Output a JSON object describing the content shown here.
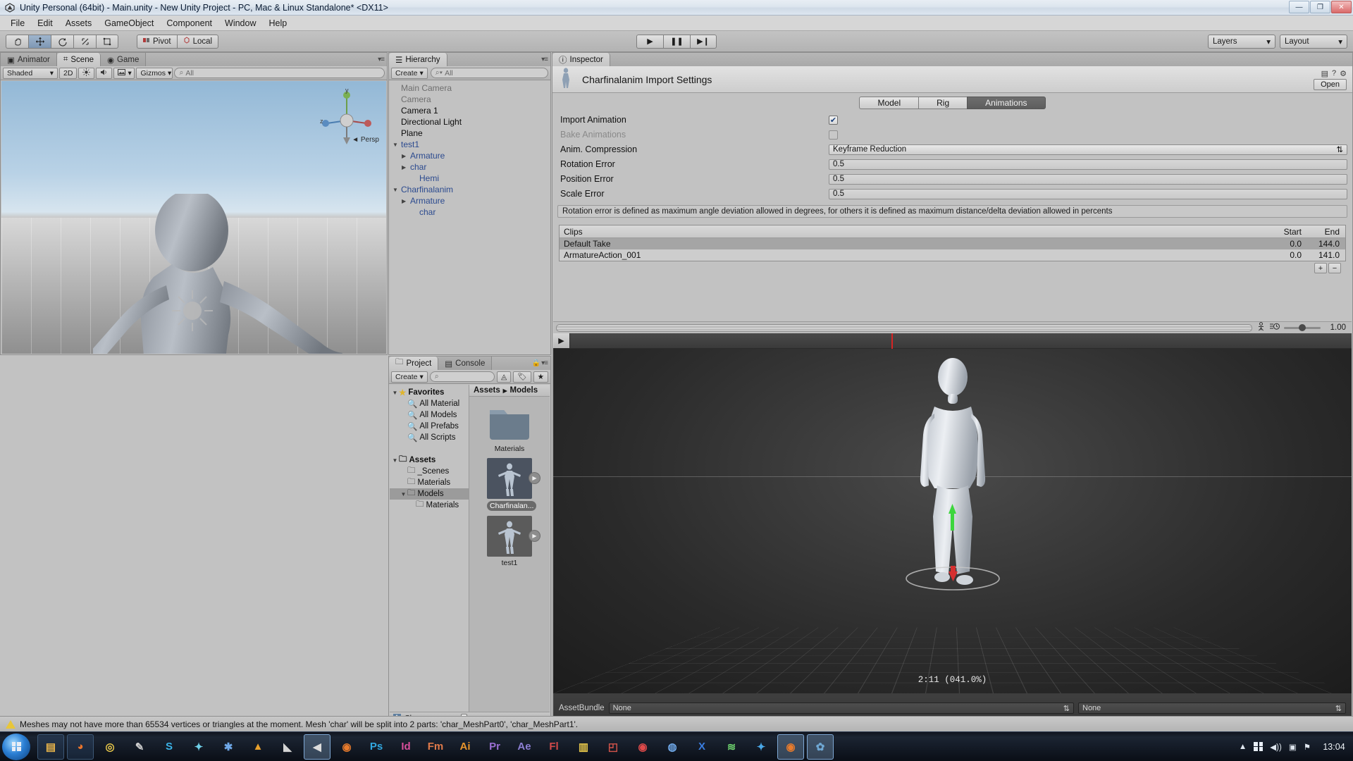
{
  "window": {
    "title": "Unity Personal (64bit) - Main.unity - New Unity Project - PC, Mac & Linux Standalone* <DX11>",
    "minimize": "—",
    "maximize": "❐",
    "close": "✕"
  },
  "menubar": {
    "items": [
      "File",
      "Edit",
      "Assets",
      "GameObject",
      "Component",
      "Window",
      "Help"
    ]
  },
  "toolbar": {
    "tools": [
      "hand-tool",
      "move-tool",
      "rotate-tool",
      "scale-tool",
      "rect-tool"
    ],
    "pivot_label": "Pivot",
    "space_label": "Local",
    "play": "▶",
    "pause": "❚❚",
    "step": "▶❙",
    "layers_label": "Layers",
    "layout_label": "Layout"
  },
  "scene": {
    "tabs": [
      {
        "label": "Scene",
        "active": true
      },
      {
        "label": "Game",
        "active": false
      },
      {
        "label": "Animator",
        "active": false
      }
    ],
    "shading_mode": "Shaded",
    "mode_2d": "2D",
    "gizmos_label": "Gizmos",
    "search_placeholder": "All",
    "axis_x": "x",
    "axis_y": "y",
    "axis_z": "z",
    "persp_label": "Persp"
  },
  "hierarchy": {
    "tab_label": "Hierarchy",
    "create_label": "Create",
    "search_placeholder": "All",
    "items": [
      {
        "label": "Main Camera",
        "indent": 0,
        "arrow": "",
        "style": "dim"
      },
      {
        "label": "Camera",
        "indent": 0,
        "arrow": "",
        "style": "dim"
      },
      {
        "label": "Camera 1",
        "indent": 0,
        "arrow": "",
        "style": "normal"
      },
      {
        "label": "Directional Light",
        "indent": 0,
        "arrow": "",
        "style": "normal"
      },
      {
        "label": "Plane",
        "indent": 0,
        "arrow": "",
        "style": "normal"
      },
      {
        "label": "test1",
        "indent": 0,
        "arrow": "▼",
        "style": "prefab"
      },
      {
        "label": "Armature",
        "indent": 1,
        "arrow": "▶",
        "style": "prefab"
      },
      {
        "label": "char",
        "indent": 1,
        "arrow": "▶",
        "style": "prefab"
      },
      {
        "label": "Hemi",
        "indent": 2,
        "arrow": "",
        "style": "prefab"
      },
      {
        "label": "Charfinalanim",
        "indent": 0,
        "arrow": "▼",
        "style": "prefab"
      },
      {
        "label": "Armature",
        "indent": 1,
        "arrow": "▶",
        "style": "prefab"
      },
      {
        "label": "char",
        "indent": 2,
        "arrow": "",
        "style": "prefab"
      }
    ]
  },
  "project": {
    "tabs": [
      {
        "label": "Project",
        "active": true
      },
      {
        "label": "Console",
        "active": false
      }
    ],
    "create_label": "Create",
    "search_placeholder": "",
    "tree": [
      {
        "label": "Favorites",
        "indent": 0,
        "arrow": "▼",
        "icon": "star-icon",
        "bold": true,
        "selected": false
      },
      {
        "label": "All Material",
        "indent": 1,
        "arrow": "",
        "icon": "search-icon",
        "bold": false,
        "selected": false
      },
      {
        "label": "All Models",
        "indent": 1,
        "arrow": "",
        "icon": "search-icon",
        "bold": false,
        "selected": false
      },
      {
        "label": "All Prefabs",
        "indent": 1,
        "arrow": "",
        "icon": "search-icon",
        "bold": false,
        "selected": false
      },
      {
        "label": "All Scripts",
        "indent": 1,
        "arrow": "",
        "icon": "search-icon",
        "bold": false,
        "selected": false
      },
      {
        "label": "",
        "indent": 0,
        "arrow": "",
        "icon": "",
        "bold": false,
        "selected": false
      },
      {
        "label": "Assets",
        "indent": 0,
        "arrow": "▼",
        "icon": "folder-icon",
        "bold": true,
        "selected": false
      },
      {
        "label": "_Scenes",
        "indent": 1,
        "arrow": "",
        "icon": "folder-icon",
        "bold": false,
        "selected": false
      },
      {
        "label": "Materials",
        "indent": 1,
        "arrow": "",
        "icon": "folder-icon",
        "bold": false,
        "selected": false
      },
      {
        "label": "Models",
        "indent": 1,
        "arrow": "▼",
        "icon": "folder-icon",
        "bold": false,
        "selected": true
      },
      {
        "label": "Materials",
        "indent": 2,
        "arrow": "",
        "icon": "folder-icon",
        "bold": false,
        "selected": false
      }
    ],
    "breadcrumb": [
      "Assets",
      "Models"
    ],
    "breadcrumb_sep": "▸",
    "assets": [
      {
        "label": "Materials",
        "type": "folder",
        "selected": false,
        "has_play": false
      },
      {
        "label": "Charfinalan...",
        "type": "model",
        "selected": true,
        "has_play": true
      },
      {
        "label": "test1",
        "type": "model",
        "selected": false,
        "has_play": true
      }
    ],
    "footer_label": "Char"
  },
  "inspector": {
    "tab_label": "Inspector",
    "title": "Charfinalanim Import Settings",
    "open_label": "Open",
    "mode_tabs": [
      {
        "label": "Model",
        "active": false
      },
      {
        "label": "Rig",
        "active": false
      },
      {
        "label": "Animations",
        "active": true
      }
    ],
    "fields": [
      {
        "label": "Import Animation",
        "type": "checkbox",
        "value": "✔",
        "checked": true,
        "disabled": false
      },
      {
        "label": "Bake Animations",
        "type": "checkbox",
        "value": "",
        "checked": false,
        "disabled": true
      },
      {
        "label": "Anim. Compression",
        "type": "popup",
        "value": "Keyframe Reduction",
        "disabled": false
      },
      {
        "label": "Rotation Error",
        "type": "text",
        "value": "0.5",
        "disabled": false
      },
      {
        "label": "Position Error",
        "type": "text",
        "value": "0.5",
        "disabled": false
      },
      {
        "label": "Scale Error",
        "type": "text",
        "value": "0.5",
        "disabled": false
      }
    ],
    "helpbox": "Rotation error is defined as maximum angle deviation allowed in degrees, for others it is defined as maximum distance/delta deviation allowed in percents",
    "clips": {
      "header": {
        "name": "Clips",
        "start": "Start",
        "end": "End"
      },
      "rows": [
        {
          "name": "Default Take",
          "start": "0.0",
          "end": "144.0",
          "selected": true
        },
        {
          "name": "ArmatureAction_001",
          "start": "0.0",
          "end": "141.0",
          "selected": false
        }
      ],
      "add_label": "+",
      "remove_label": "−"
    },
    "preview": {
      "play_label": "▶",
      "speed_value": "1.00",
      "time_label": "2:11 (041.0%)"
    },
    "assetbundle": {
      "label": "AssetBundle",
      "bundle_value": "None",
      "variant_value": "None"
    }
  },
  "statusbar": {
    "message": "Meshes may not have more than 65534 vertices or triangles at the moment. Mesh 'char' will be split into 2 parts: 'char_MeshPart0', 'char_MeshPart1'."
  },
  "taskbar": {
    "items": [
      {
        "name": "explorer-icon",
        "glyph": "▤",
        "color": "#e8b44a",
        "state": "pinned"
      },
      {
        "name": "firefox-icon",
        "glyph": "◕",
        "color": "#e8742c",
        "state": "pinned"
      },
      {
        "name": "chrome-icon",
        "glyph": "◎",
        "color": "#e8c84a",
        "state": "normal"
      },
      {
        "name": "feather-icon",
        "glyph": "✎",
        "color": "#cfcfcf",
        "state": "normal"
      },
      {
        "name": "skype-icon",
        "glyph": "S",
        "color": "#3bb3e8",
        "state": "normal"
      },
      {
        "name": "sketch-icon",
        "glyph": "✦",
        "color": "#6fd0e8",
        "state": "normal"
      },
      {
        "name": "sync-icon",
        "glyph": "✱",
        "color": "#6fa8e8",
        "state": "normal"
      },
      {
        "name": "vlc-icon",
        "glyph": "▲",
        "color": "#e8a02c",
        "state": "normal"
      },
      {
        "name": "shield-icon",
        "glyph": "◣",
        "color": "#d4d4d4",
        "state": "normal"
      },
      {
        "name": "unity-icon",
        "glyph": "◀",
        "color": "#dcdcdc",
        "state": "active"
      },
      {
        "name": "blender-icon",
        "glyph": "◉",
        "color": "#e87b2c",
        "state": "normal"
      },
      {
        "name": "photoshop-icon",
        "glyph": "Ps",
        "color": "#31a8e0",
        "state": "normal"
      },
      {
        "name": "indesign-icon",
        "glyph": "Id",
        "color": "#d94f9c",
        "state": "normal"
      },
      {
        "name": "framemaker-icon",
        "glyph": "Fm",
        "color": "#e07a4a",
        "state": "normal"
      },
      {
        "name": "illustrator-icon",
        "glyph": "Ai",
        "color": "#e8952c",
        "state": "normal"
      },
      {
        "name": "premiere-icon",
        "glyph": "Pr",
        "color": "#9b6fd4",
        "state": "normal"
      },
      {
        "name": "aftereffects-icon",
        "glyph": "Ae",
        "color": "#8c7fd4",
        "state": "normal"
      },
      {
        "name": "flash-icon",
        "glyph": "Fl",
        "color": "#d44a4a",
        "state": "normal"
      },
      {
        "name": "notes-icon",
        "glyph": "▥",
        "color": "#e8c84a",
        "state": "normal"
      },
      {
        "name": "office-icon",
        "glyph": "◰",
        "color": "#d4544a",
        "state": "normal"
      },
      {
        "name": "recorder-icon",
        "glyph": "◉",
        "color": "#e04a4a",
        "state": "normal"
      },
      {
        "name": "compass-icon",
        "glyph": "◍",
        "color": "#6fa8e8",
        "state": "normal"
      },
      {
        "name": "excel-icon",
        "glyph": "X",
        "color": "#3a7de0",
        "state": "normal"
      },
      {
        "name": "wifi-icon",
        "glyph": "≋",
        "color": "#6fd46f",
        "state": "normal"
      },
      {
        "name": "bluetooth-icon",
        "glyph": "✦",
        "color": "#4aa8e8",
        "state": "normal"
      },
      {
        "name": "blender2-icon",
        "glyph": "◉",
        "color": "#e87b2c",
        "state": "active"
      },
      {
        "name": "paint-icon",
        "glyph": "✿",
        "color": "#6fa8d4",
        "state": "active"
      }
    ],
    "tray": {
      "overflow": "▲",
      "volume": "◀))",
      "network": "▣",
      "flag": "⚑",
      "clock": "13:04"
    }
  }
}
